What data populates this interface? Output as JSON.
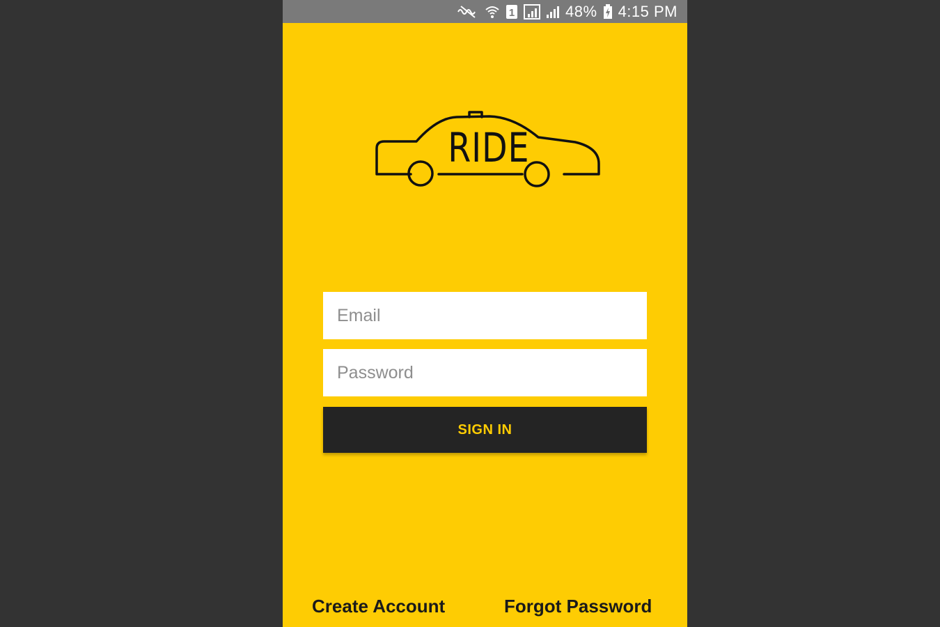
{
  "status_bar": {
    "battery": "48%",
    "time": "4:15 PM",
    "sim_label": "1",
    "icons": [
      "mute-icon",
      "wifi-icon",
      "sim-icon",
      "signal-icon",
      "signal-icon",
      "battery-charging-icon"
    ]
  },
  "logo": {
    "text": "RIDE"
  },
  "form": {
    "email_placeholder": "Email",
    "password_placeholder": "Password",
    "signin_label": "SIGN IN"
  },
  "links": {
    "create_account": "Create Account",
    "forgot_password": "Forgot Password"
  },
  "colors": {
    "background": "#333333",
    "brand_yellow": "#FECC03",
    "button_dark": "#242424"
  }
}
